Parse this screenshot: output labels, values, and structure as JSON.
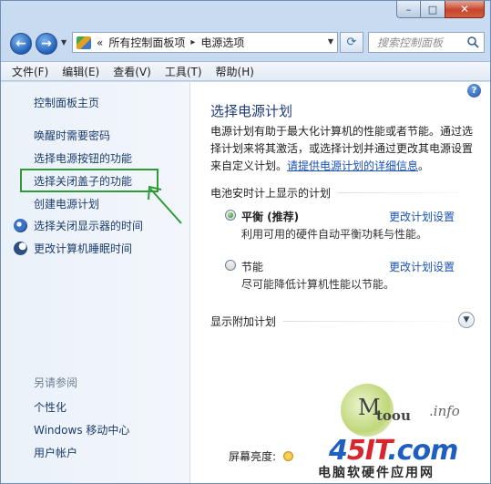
{
  "window": {
    "caption": {
      "minimize": "–",
      "maximize": "□",
      "close": "✕"
    }
  },
  "nav": {
    "back_icon": "back-arrow-icon",
    "forward_icon": "forward-arrow-icon",
    "address_prefix": "«",
    "breadcrumb": [
      "所有控制面板项",
      "电源选项"
    ],
    "breadcrumb_sep": "▸",
    "search_placeholder": "搜索控制面板"
  },
  "menubar": {
    "items": [
      "文件(F)",
      "编辑(E)",
      "查看(V)",
      "工具(T)",
      "帮助(H)"
    ]
  },
  "sidebar": {
    "home": "控制面板主页",
    "links": [
      "唤醒时需要密码",
      "选择电源按钮的功能",
      "选择关闭盖子的功能",
      "创建电源计划"
    ],
    "icon_links": [
      "选择关闭显示器的时间",
      "更改计算机睡眠时间"
    ],
    "see_also_title": "另请参阅",
    "see_also": [
      "个性化",
      "Windows 移动中心",
      "用户帐户"
    ]
  },
  "main": {
    "help_label": "?",
    "title": "选择电源计划",
    "desc_lines": [
      "电源计划有助于最大化计算机的性能或者节能。通过选",
      "择计划来将其激活，或选择计划并通过更改其电源设置"
    ],
    "desc_last": "来自定义计划。",
    "desc_link": "请提供电源计划的详细信息",
    "desc_end": "。",
    "battery_section": "电池安时计上显示的计划",
    "plans": [
      {
        "name": "平衡 (推荐)",
        "desc": "利用可用的硬件自动平衡功耗与性能。",
        "link": "更改计划设置",
        "selected": true
      },
      {
        "name": "节能",
        "desc": "尽可能降低计算机性能以节能。",
        "link": "更改计划设置",
        "selected": false
      }
    ],
    "extra_section": "显示附加计划",
    "brightness_label": "屏幕亮度:"
  },
  "watermark": {
    "m": "M",
    "toou": "toou",
    "info": ".info",
    "brand_a": "4",
    "brand_b": "5IT",
    "brand_c": ".com",
    "sub": "电脑软硬件应用网"
  }
}
